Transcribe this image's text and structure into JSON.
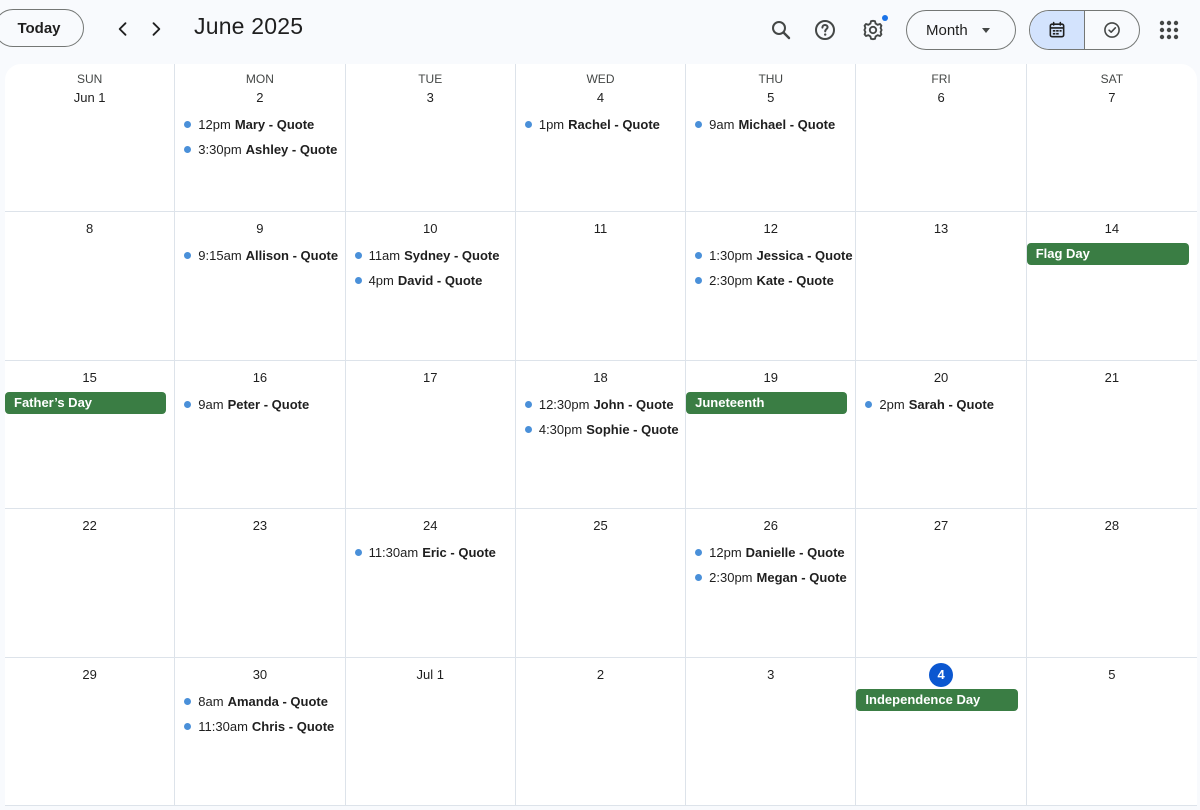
{
  "header": {
    "today_label": "Today",
    "title": "June 2025",
    "view_label": "Month",
    "icons": [
      "search-icon",
      "help-icon",
      "settings-icon",
      "calendar-view-icon",
      "tasks-view-icon",
      "apps-grid-icon"
    ]
  },
  "colors": {
    "event_dot": "#4a90d9",
    "allday_event": "#3a7d44",
    "today_circle": "#0b57d0",
    "active_toggle": "#d3e3fd"
  },
  "weekdays": [
    "SUN",
    "MON",
    "TUE",
    "WED",
    "THU",
    "FRI",
    "SAT"
  ],
  "days": [
    {
      "label": "Jun 1",
      "events": []
    },
    {
      "label": "2",
      "events": [
        {
          "time": "12pm",
          "title": "Mary - Quote"
        },
        {
          "time": "3:30pm",
          "title": "Ashley - Quote"
        }
      ]
    },
    {
      "label": "3",
      "events": []
    },
    {
      "label": "4",
      "events": [
        {
          "time": "1pm",
          "title": "Rachel - Quote"
        }
      ]
    },
    {
      "label": "5",
      "events": [
        {
          "time": "9am",
          "title": "Michael - Quote"
        }
      ]
    },
    {
      "label": "6",
      "events": []
    },
    {
      "label": "7",
      "events": []
    },
    {
      "label": "8",
      "events": []
    },
    {
      "label": "9",
      "events": [
        {
          "time": "9:15am",
          "title": "Allison - Quote"
        }
      ]
    },
    {
      "label": "10",
      "events": [
        {
          "time": "11am",
          "title": "Sydney - Quote"
        },
        {
          "time": "4pm",
          "title": "David - Quote"
        }
      ]
    },
    {
      "label": "11",
      "events": []
    },
    {
      "label": "12",
      "events": [
        {
          "time": "1:30pm",
          "title": "Jessica - Quote"
        },
        {
          "time": "2:30pm",
          "title": "Kate - Quote"
        }
      ]
    },
    {
      "label": "13",
      "events": []
    },
    {
      "label": "14",
      "allday": "Flag Day",
      "events": []
    },
    {
      "label": "15",
      "allday": "Father’s Day",
      "events": []
    },
    {
      "label": "16",
      "events": [
        {
          "time": "9am",
          "title": "Peter - Quote"
        }
      ]
    },
    {
      "label": "17",
      "events": []
    },
    {
      "label": "18",
      "events": [
        {
          "time": "12:30pm",
          "title": "John - Quote"
        },
        {
          "time": "4:30pm",
          "title": "Sophie - Quote"
        }
      ]
    },
    {
      "label": "19",
      "allday": "Juneteenth",
      "events": []
    },
    {
      "label": "20",
      "events": [
        {
          "time": "2pm",
          "title": "Sarah - Quote"
        }
      ]
    },
    {
      "label": "21",
      "events": []
    },
    {
      "label": "22",
      "events": []
    },
    {
      "label": "23",
      "events": []
    },
    {
      "label": "24",
      "events": [
        {
          "time": "11:30am",
          "title": "Eric - Quote"
        }
      ]
    },
    {
      "label": "25",
      "events": []
    },
    {
      "label": "26",
      "events": [
        {
          "time": "12pm",
          "title": "Danielle - Quote"
        },
        {
          "time": "2:30pm",
          "title": "Megan - Quote"
        }
      ]
    },
    {
      "label": "27",
      "events": []
    },
    {
      "label": "28",
      "events": []
    },
    {
      "label": "29",
      "events": []
    },
    {
      "label": "30",
      "events": [
        {
          "time": "8am",
          "title": "Amanda - Quote"
        },
        {
          "time": "11:30am",
          "title": "Chris - Quote"
        }
      ]
    },
    {
      "label": "Jul 1",
      "events": []
    },
    {
      "label": "2",
      "events": []
    },
    {
      "label": "3",
      "events": []
    },
    {
      "label": "4",
      "today": true,
      "allday": "Independence Day",
      "events": []
    },
    {
      "label": "5",
      "events": []
    }
  ]
}
